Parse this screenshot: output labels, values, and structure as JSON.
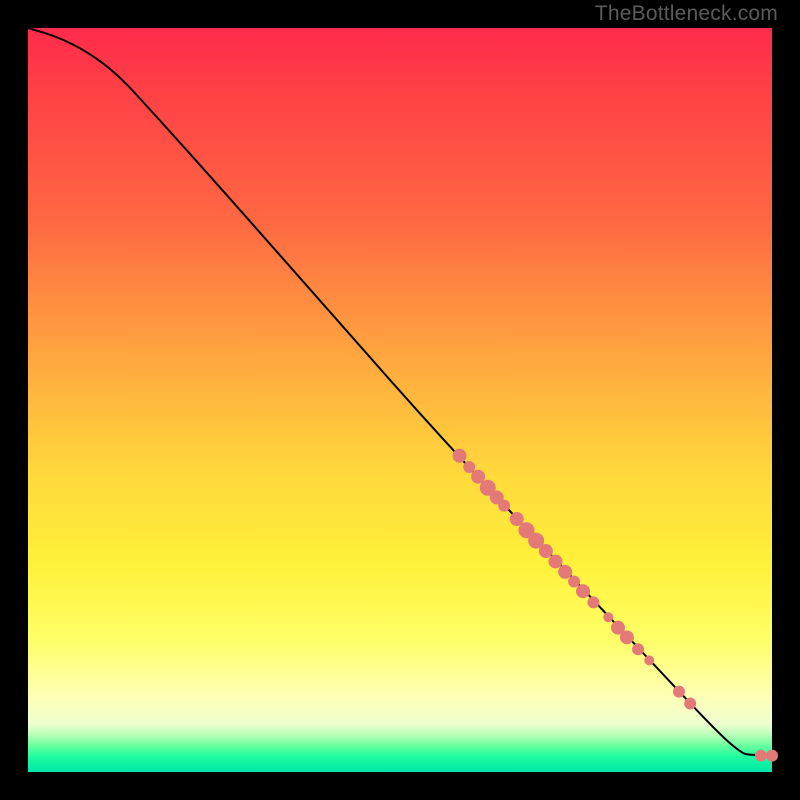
{
  "watermark": "TheBottleneck.com",
  "colors": {
    "dot": "#e47a78",
    "curve": "#000000",
    "gradient_top": "#ff2b4b",
    "gradient_bottom": "#00e6a8"
  },
  "chart_data": {
    "type": "line",
    "title": "",
    "xlabel": "",
    "ylabel": "",
    "xlim": [
      0,
      100
    ],
    "ylim": [
      0,
      100
    ],
    "curve": [
      {
        "x": 0,
        "y": 100
      },
      {
        "x": 4,
        "y": 98.8
      },
      {
        "x": 8,
        "y": 96.8
      },
      {
        "x": 12,
        "y": 93.8
      },
      {
        "x": 16,
        "y": 89.5
      },
      {
        "x": 25,
        "y": 79.5
      },
      {
        "x": 40,
        "y": 62.5
      },
      {
        "x": 55,
        "y": 45.5
      },
      {
        "x": 70,
        "y": 29.5
      },
      {
        "x": 85,
        "y": 13.5
      },
      {
        "x": 93,
        "y": 5.0
      },
      {
        "x": 96,
        "y": 2.5
      },
      {
        "x": 97,
        "y": 2.3
      },
      {
        "x": 100,
        "y": 2.2
      }
    ],
    "points": [
      {
        "x": 58.0,
        "y": 42.5,
        "r": 7
      },
      {
        "x": 59.3,
        "y": 41.0,
        "r": 6
      },
      {
        "x": 60.5,
        "y": 39.7,
        "r": 7
      },
      {
        "x": 61.8,
        "y": 38.2,
        "r": 8
      },
      {
        "x": 63.0,
        "y": 36.9,
        "r": 7
      },
      {
        "x": 64.0,
        "y": 35.8,
        "r": 6
      },
      {
        "x": 65.7,
        "y": 34.0,
        "r": 7
      },
      {
        "x": 67.0,
        "y": 32.5,
        "r": 8
      },
      {
        "x": 68.3,
        "y": 31.1,
        "r": 8
      },
      {
        "x": 69.6,
        "y": 29.7,
        "r": 7
      },
      {
        "x": 70.9,
        "y": 28.3,
        "r": 7
      },
      {
        "x": 72.2,
        "y": 26.9,
        "r": 7
      },
      {
        "x": 73.4,
        "y": 25.6,
        "r": 6
      },
      {
        "x": 74.6,
        "y": 24.3,
        "r": 7
      },
      {
        "x": 76.0,
        "y": 22.8,
        "r": 6
      },
      {
        "x": 78.0,
        "y": 20.8,
        "r": 5
      },
      {
        "x": 79.3,
        "y": 19.4,
        "r": 7
      },
      {
        "x": 80.5,
        "y": 18.1,
        "r": 7
      },
      {
        "x": 82.0,
        "y": 16.5,
        "r": 6
      },
      {
        "x": 83.5,
        "y": 15.0,
        "r": 5
      },
      {
        "x": 87.5,
        "y": 10.8,
        "r": 6
      },
      {
        "x": 89.0,
        "y": 9.2,
        "r": 6
      },
      {
        "x": 98.5,
        "y": 2.2,
        "r": 6
      },
      {
        "x": 100.0,
        "y": 2.2,
        "r": 6
      }
    ]
  }
}
